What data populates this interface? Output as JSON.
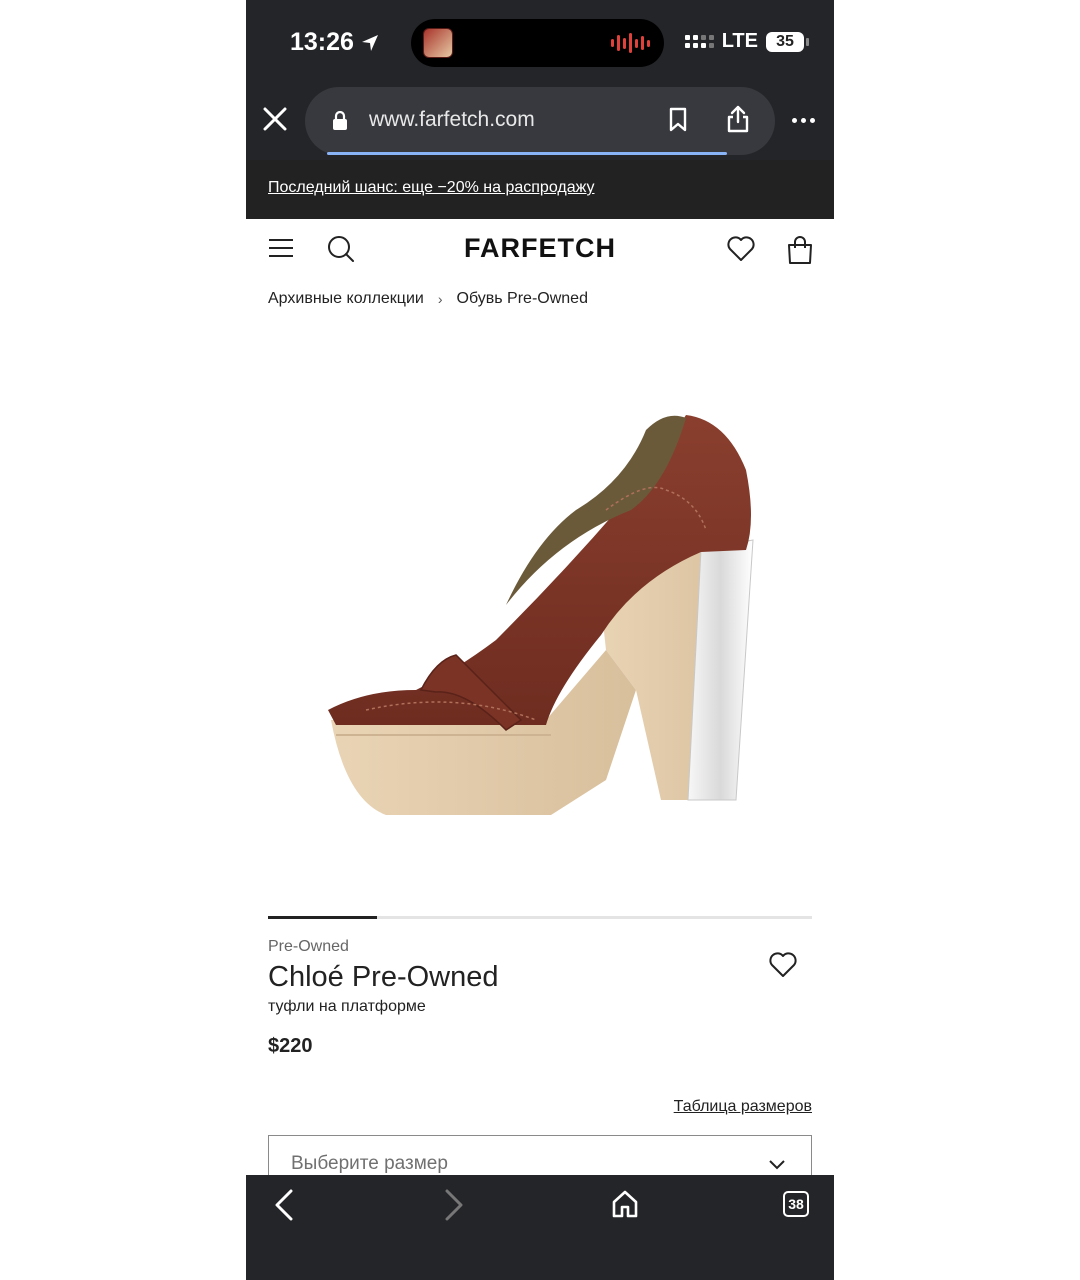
{
  "status": {
    "time": "13:26",
    "network": "LTE",
    "battery": "35"
  },
  "browser": {
    "url": "www.farfetch.com",
    "tab_count": "38"
  },
  "promo": {
    "text": "Последний шанс: еще −20% на распродажу"
  },
  "site": {
    "logo": "FARFETCH"
  },
  "breadcrumb": {
    "items": [
      "Архивные коллекции",
      "Обувь Pre-Owned"
    ],
    "separator": "›"
  },
  "product": {
    "condition": "Pre-Owned",
    "brand": "Chloé Pre-Owned",
    "description": "туфли на платформе",
    "price": "$220",
    "size_guide": "Таблица размеров",
    "size_placeholder": "Выберите размер",
    "carousel_progress": 0.2
  },
  "colors": {
    "chrome": "#242528",
    "accent_progress": "#8ab4f8",
    "text": "#222222"
  },
  "icons": [
    "location-arrow-icon",
    "close-icon",
    "lock-icon",
    "bookmark-icon",
    "share-icon",
    "more-icon",
    "menu-icon",
    "search-icon",
    "heart-icon",
    "bag-icon",
    "chevron-down-icon",
    "back-icon",
    "forward-icon",
    "home-icon",
    "tabs-icon"
  ]
}
